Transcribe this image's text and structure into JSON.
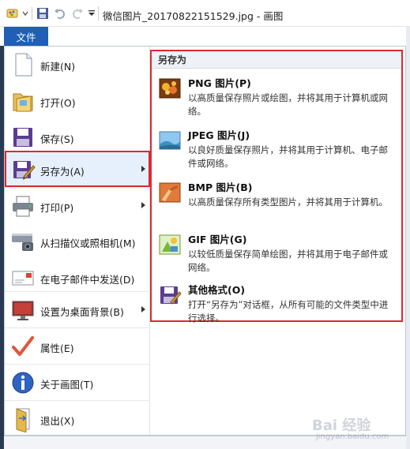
{
  "window": {
    "title": "微信图片_20170822151529.jpg - 画图"
  },
  "ribbon": {
    "file_tab": "文件"
  },
  "menu": {
    "items": [
      {
        "label": "新建(N)",
        "icon": "new-file-icon"
      },
      {
        "label": "打开(O)",
        "icon": "open-folder-icon"
      },
      {
        "label": "保存(S)",
        "icon": "save-icon"
      },
      {
        "label": "另存为(A)",
        "icon": "save-as-icon",
        "submenu": true,
        "active": true
      },
      {
        "label": "打印(P)",
        "icon": "printer-icon",
        "submenu": true
      },
      {
        "label": "从扫描仪或照相机(M)",
        "icon": "scanner-icon"
      },
      {
        "label": "在电子邮件中发送(D)",
        "icon": "email-icon"
      },
      {
        "label": "设置为桌面背景(B)",
        "icon": "desktop-background-icon",
        "submenu": true
      },
      {
        "label": "属性(E)",
        "icon": "checkmark-icon"
      },
      {
        "label": "关于画图(T)",
        "icon": "info-icon"
      },
      {
        "label": "退出(X)",
        "icon": "exit-icon"
      }
    ]
  },
  "submenu": {
    "title": "另存为",
    "items": [
      {
        "title": "PNG 图片(P)",
        "desc": "以高质量保存照片或绘图，并将其用于计算机或网络。",
        "icon": "png-image-icon"
      },
      {
        "title": "JPEG 图片(J)",
        "desc": "以良好质量保存照片，并将其用于计算机、电子邮件或网络。",
        "icon": "jpeg-image-icon"
      },
      {
        "title": "BMP 图片(B)",
        "desc": "以高质量保存所有类型图片，并将其用于计算机。",
        "icon": "bmp-image-icon"
      },
      {
        "title": "GIF 图片(G)",
        "desc": "以较低质量保存简单绘图，并将其用于电子邮件或网络。",
        "icon": "gif-image-icon"
      },
      {
        "title": "其他格式(O)",
        "desc": "打开“另存为”对话框，从所有可能的文件类型中进行选择。",
        "icon": "other-formats-icon"
      }
    ]
  },
  "colors": {
    "file_tab": "#1f5fb5",
    "highlight_border": "#e0282e",
    "active_item_bg": "#e5f0fc"
  },
  "watermark": {
    "logo_text": "Bai 经验",
    "url": "jingyan.baidu.com"
  }
}
